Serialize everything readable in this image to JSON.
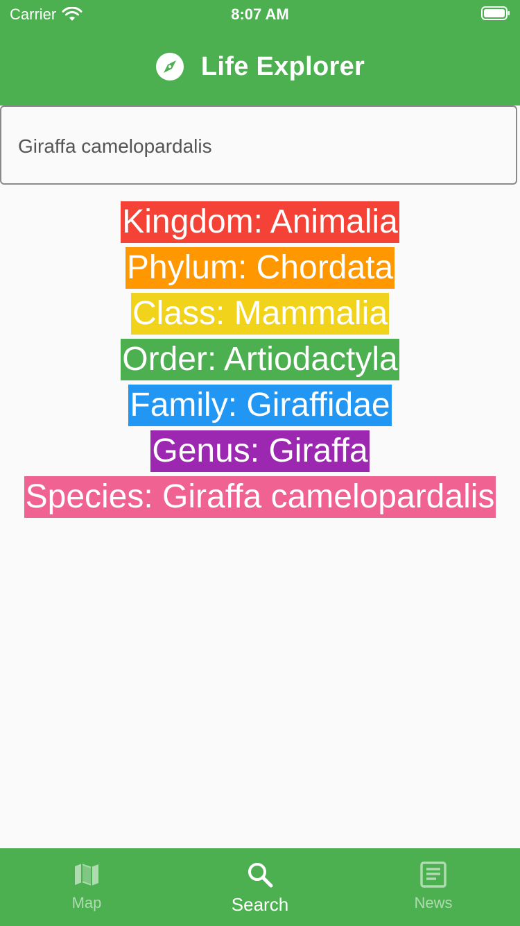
{
  "status_bar": {
    "carrier": "Carrier",
    "time": "8:07 AM"
  },
  "app_bar": {
    "title": "Life Explorer",
    "logo_icon": "compass-icon"
  },
  "search": {
    "value": "Giraffa camelopardalis",
    "placeholder": ""
  },
  "taxonomy": [
    {
      "label": "Kingdom: Animalia",
      "color": "#f44336"
    },
    {
      "label": "Phylum: Chordata",
      "color": "#ff9800"
    },
    {
      "label": "Class: Mammalia",
      "color": "#f2d31b"
    },
    {
      "label": "Order: Artiodactyla",
      "color": "#4caf50"
    },
    {
      "label": "Family: Giraffidae",
      "color": "#2196f3"
    },
    {
      "label": "Genus: Giraffa",
      "color": "#9c27b0"
    },
    {
      "label": "Species: Giraffa camelopardalis",
      "color": "#f06292"
    }
  ],
  "bottom_nav": {
    "items": [
      {
        "label": "Map",
        "icon": "map-icon",
        "active": false
      },
      {
        "label": "Search",
        "icon": "search-icon",
        "active": true
      },
      {
        "label": "News",
        "icon": "news-icon",
        "active": false
      }
    ]
  },
  "colors": {
    "primary": "#4caf50",
    "background": "#fafafa"
  }
}
